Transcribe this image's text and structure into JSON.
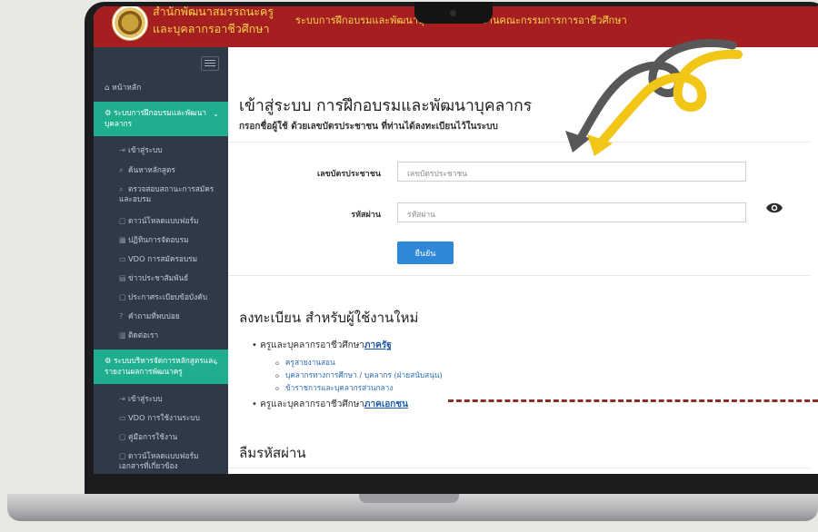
{
  "header": {
    "org_line1": "สำนักพัฒนาสมรรถนะครู",
    "org_line2": "และบุคลากรอาชีวศึกษา",
    "system_name": "ระบบการฝึกอบรมและพัฒนาบุคลากร สำนักงานคณะกรรมการการอาชีวศึกษา"
  },
  "sidebar": {
    "home": "หน้าหลัก",
    "section1": "ระบบการฝึกอบรมและพัฒนาบุคลากร",
    "section1_items": [
      "เข้าสู่ระบบ",
      "ค้นหาหลักสูตร",
      "ตรวจสอบสถานะการสมัครและอบรม",
      "ดาวน์โหลดแบบฟอร์ม",
      "ปฏิทินการจัดอบรม",
      "VDO การสมัครอบรม",
      "ข่าวประชาสัมพันธ์",
      "ประกาศระเบียบข้อบังคับ",
      "คำถามที่พบบ่อย",
      "ติดต่อเรา"
    ],
    "section2": "ระบบบริหารจัดการหลักสูตรและรายงานผลการพัฒนาครู",
    "section2_items": [
      "เข้าสู่ระบบ",
      "VDO การใช้งานระบบ",
      "คู่มือการใช้งาน",
      "ดาวน์โหลดแบบฟอร์มเอกสารที่เกี่ยวข้อง"
    ]
  },
  "login": {
    "title": "เข้าสู่ระบบ การฝึกอบรมและพัฒนาบุคลากร",
    "hint": "กรอกชื่อผู้ใช้ ด้วยเลขบัตรประชาชน ที่ท่านได้ลงทะเบียนไว้ในระบบ",
    "id_label": "เลขบัตรประชาชน",
    "id_placeholder": "เลขบัตรประชาชน",
    "pw_label": "รหัสผ่าน",
    "pw_placeholder": "รหัสผ่าน",
    "submit": "ยืนยัน"
  },
  "register": {
    "title": "ลงทะเบียน สำหรับผู้ใช้งานใหม่",
    "gov_prefix": "ครูและบุคลากรอาชีวศึกษา",
    "gov_link": "ภาครัฐ",
    "gov_items": [
      "ครูสายงานสอน",
      "บุคลากรทางการศึกษา / บุคลากร (ฝ่ายสนับสนุน)",
      "ข้าราชการและบุคลากรส่วนกลาง"
    ],
    "private_prefix": "ครูและบุคลากรอาชีวศึกษา",
    "private_link": "ภาคเอกชน"
  },
  "forgot": {
    "title": "ลืมรหัสผ่าน"
  },
  "colors": {
    "header": "#a51e20",
    "header_text": "#f7d54a",
    "sidebar": "#2e3a47",
    "section_active": "#1fae8e",
    "button": "#2f87d8",
    "arrow_yellow": "#f2c617",
    "arrow_gray": "#57585a",
    "dashed_line": "#8c2d22"
  }
}
